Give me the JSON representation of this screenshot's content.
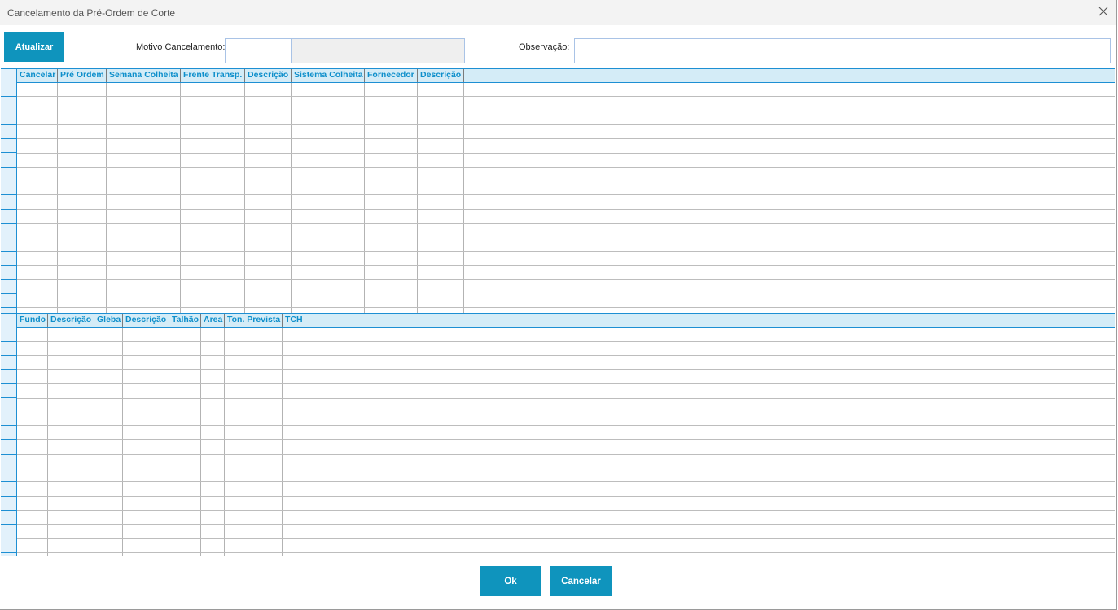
{
  "window": {
    "title": "Cancelamento da Pré-Ordem de Corte",
    "close_icon": "close-icon"
  },
  "toolbar": {
    "refresh_label": "Atualizar",
    "motivo_label": "Motivo Cancelamento:",
    "motivo_code": "",
    "motivo_desc": "",
    "obs_label": "Observação:",
    "obs_value": ""
  },
  "grid_top": {
    "columns": [
      "Cancelar",
      "Pré Ordem",
      "Semana Colheita",
      "Frente Transp.",
      "Descrição",
      "Sistema Colheita",
      "Fornecedor",
      "Descrição"
    ]
  },
  "grid_bottom": {
    "columns": [
      "Fundo",
      "Descrição",
      "Gleba",
      "Descrição",
      "Talhão",
      "Area",
      "Ton. Prevista",
      "TCH"
    ]
  },
  "footer": {
    "ok_label": "Ok",
    "cancel_label": "Cancelar"
  },
  "colors": {
    "accent": "#0f94bd",
    "grid_header_bg": "#d4ecf7",
    "grid_header_text": "#0e8fcb",
    "grid_border": "#1d8fd3"
  }
}
